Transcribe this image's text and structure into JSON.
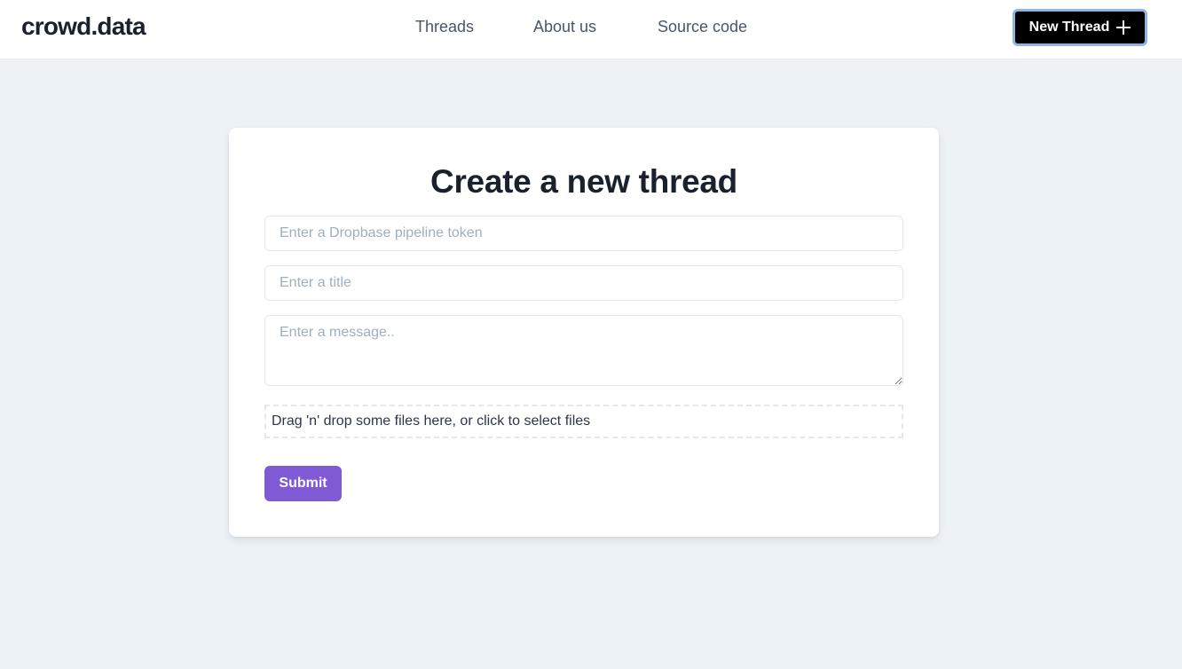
{
  "brand": {
    "name": "crowd.data"
  },
  "nav": {
    "links": [
      {
        "label": "Threads"
      },
      {
        "label": "About us"
      },
      {
        "label": "Source code"
      }
    ],
    "new_thread_label": "New Thread",
    "new_thread_icon": "plus-icon"
  },
  "form": {
    "title": "Create a new thread",
    "token": {
      "placeholder": "Enter a Dropbase pipeline token",
      "value": ""
    },
    "title_field": {
      "placeholder": "Enter a title",
      "value": ""
    },
    "message": {
      "placeholder": "Enter a message..",
      "value": ""
    },
    "dropzone_text": "Drag 'n' drop some files here, or click to select files",
    "submit_label": "Submit"
  },
  "colors": {
    "page_background": "#edf2f7",
    "header_background": "#ffffff",
    "new_thread_button": "#000000",
    "new_thread_focus_ring": "#90b4e3",
    "submit_button": "#805ad5",
    "placeholder_text": "#a0aec0",
    "nav_text": "#4a5568"
  }
}
